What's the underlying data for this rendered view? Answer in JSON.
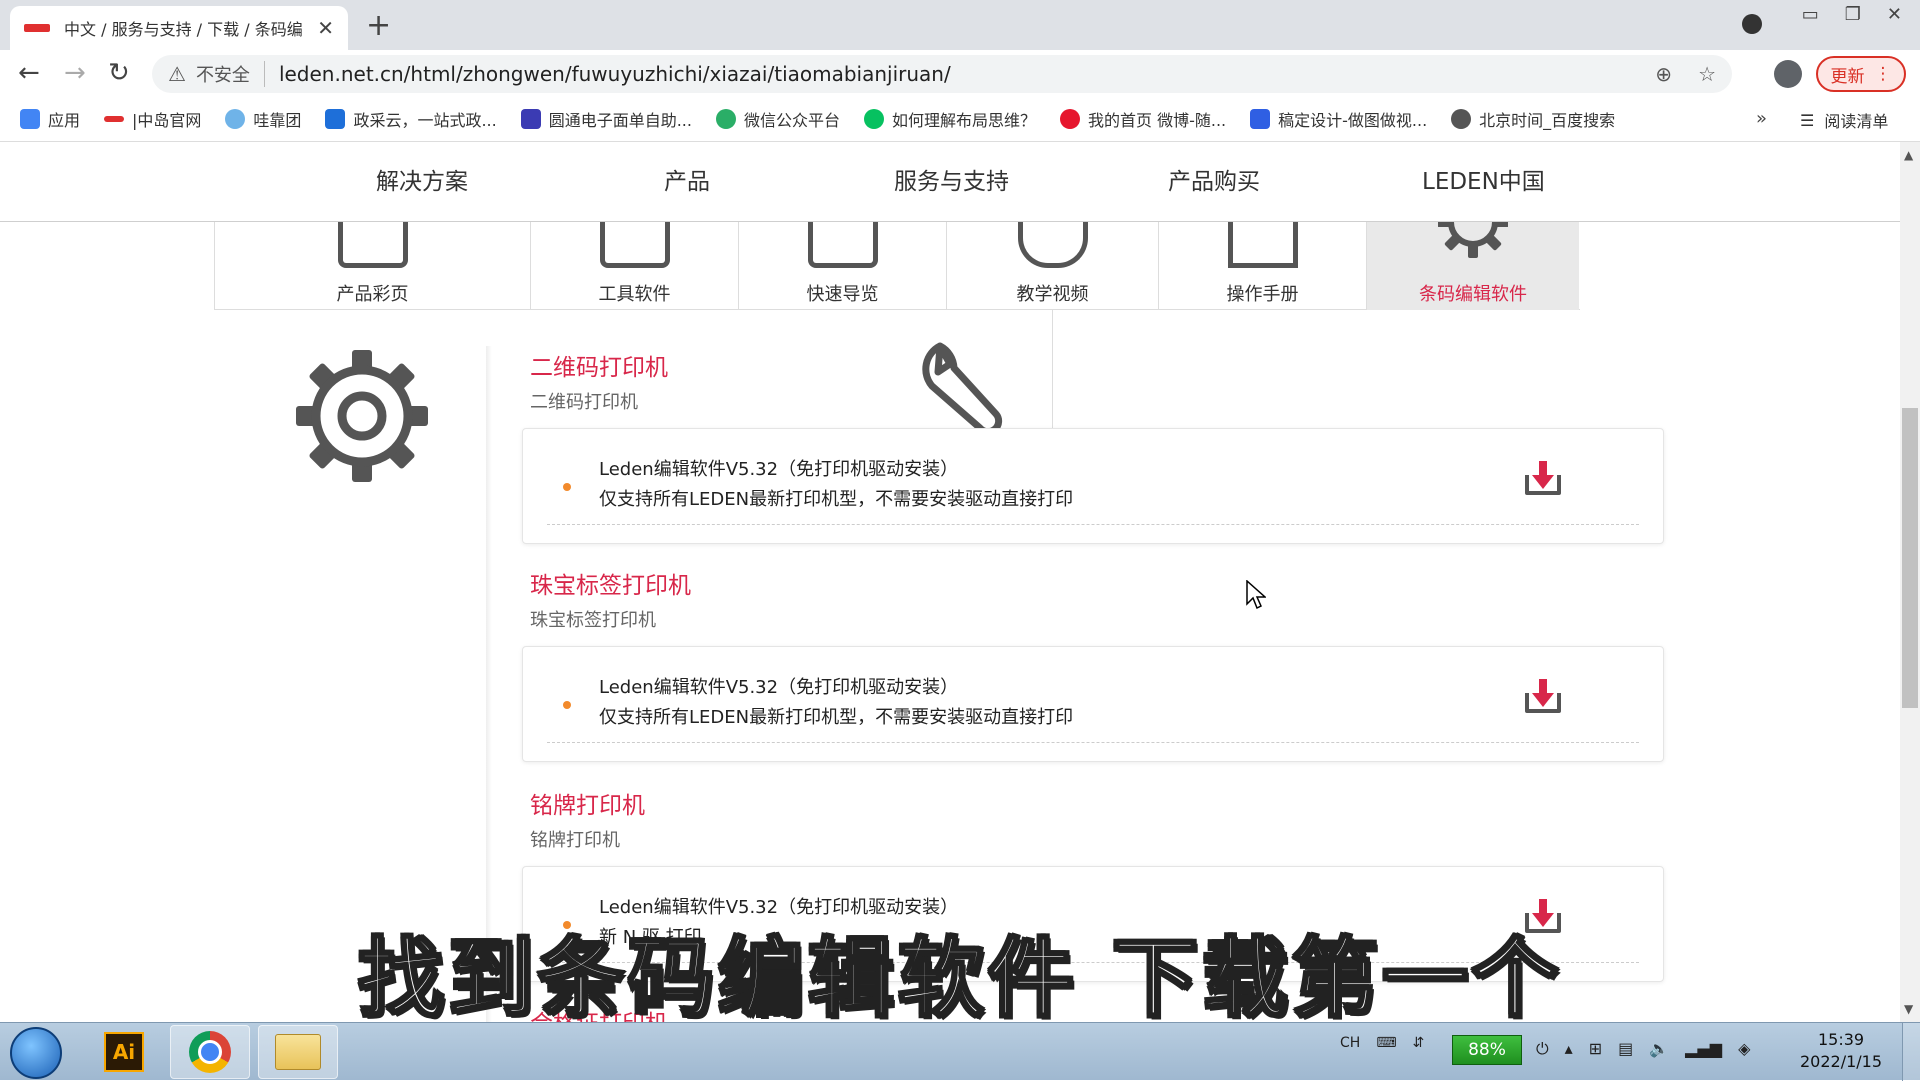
{
  "browser": {
    "tab_title": "中文 / 服务与支持 / 下载 / 条码编",
    "tab_close": "✕",
    "new_tab": "+",
    "insecure_label": "不安全",
    "url": "leden.net.cn/html/zhongwen/fuwuyuzhichi/xiazai/tiaomabianjiruan/",
    "update_label": "更新",
    "bookmarks": [
      {
        "label": "应用",
        "icon": "apps-grid-icon",
        "color": "#4285f4"
      },
      {
        "label": "|中岛官网",
        "icon": "leden-favicon",
        "color": "#e03030"
      },
      {
        "label": "哇靠团",
        "icon": "waikao-icon",
        "color": "#6fb3e8"
      },
      {
        "label": "政采云，一站式政...",
        "icon": "zhengcaiyun-icon",
        "color": "#1e6fd9"
      },
      {
        "label": "圆通电子面单自助...",
        "icon": "yuantong-icon",
        "color": "#3b3bb3"
      },
      {
        "label": "微信公众平台",
        "icon": "wechat-mp-icon",
        "color": "#2aae67"
      },
      {
        "label": "如何理解布局思维？",
        "icon": "wechat-icon",
        "color": "#07c160"
      },
      {
        "label": "我的首页 微博-随...",
        "icon": "weibo-icon",
        "color": "#e6162d"
      },
      {
        "label": "稿定设计-做图做视...",
        "icon": "gaoding-icon",
        "color": "#2f5fe3"
      },
      {
        "label": "北京时间_百度搜索",
        "icon": "globe-icon",
        "color": "#555555"
      }
    ],
    "bookmarks_more": "»",
    "reading_list": "阅读清单"
  },
  "site_nav": [
    "解决方案",
    "产品",
    "服务与支持",
    "产品购买",
    "LEDEN中国"
  ],
  "categories": [
    {
      "label": "产品彩页",
      "active": false
    },
    {
      "label": "工具软件",
      "active": false
    },
    {
      "label": "快速导览",
      "active": false
    },
    {
      "label": "教学视频",
      "active": false
    },
    {
      "label": "操作手册",
      "active": false
    },
    {
      "label": "条码编辑软件",
      "active": true
    }
  ],
  "sections": [
    {
      "title": "二维码打印机",
      "subtitle": "二维码打印机",
      "item_name": "Leden编辑软件V5.32（免打印机驱动安装）",
      "item_desc": "仅支持所有LEDEN最新打印机型，不需要安装驱动直接打印"
    },
    {
      "title": "珠宝标签打印机",
      "subtitle": "珠宝标签打印机",
      "item_name": "Leden编辑软件V5.32（免打印机驱动安装）",
      "item_desc": "仅支持所有LEDEN最新打印机型，不需要安装驱动直接打印"
    },
    {
      "title": "铭牌打印机",
      "subtitle": "铭牌打印机",
      "item_name": "Leden编辑软件V5.32（免打印机驱动安装）",
      "item_desc": "新   N                          驱     打印"
    }
  ],
  "next_section_title": "合格证打印机",
  "overlay_subtitle": "找到条码编辑软件 下载第一个",
  "colors": {
    "accent": "#d8274a",
    "dot": "#f28a2c",
    "update": "#d93025"
  },
  "taskbar": {
    "apps": [
      "illustrator-icon",
      "chrome-icon",
      "file-explorer-icon"
    ],
    "ime": "CH",
    "battery": "88%",
    "time": "15:39",
    "date": "2022/1/15"
  }
}
